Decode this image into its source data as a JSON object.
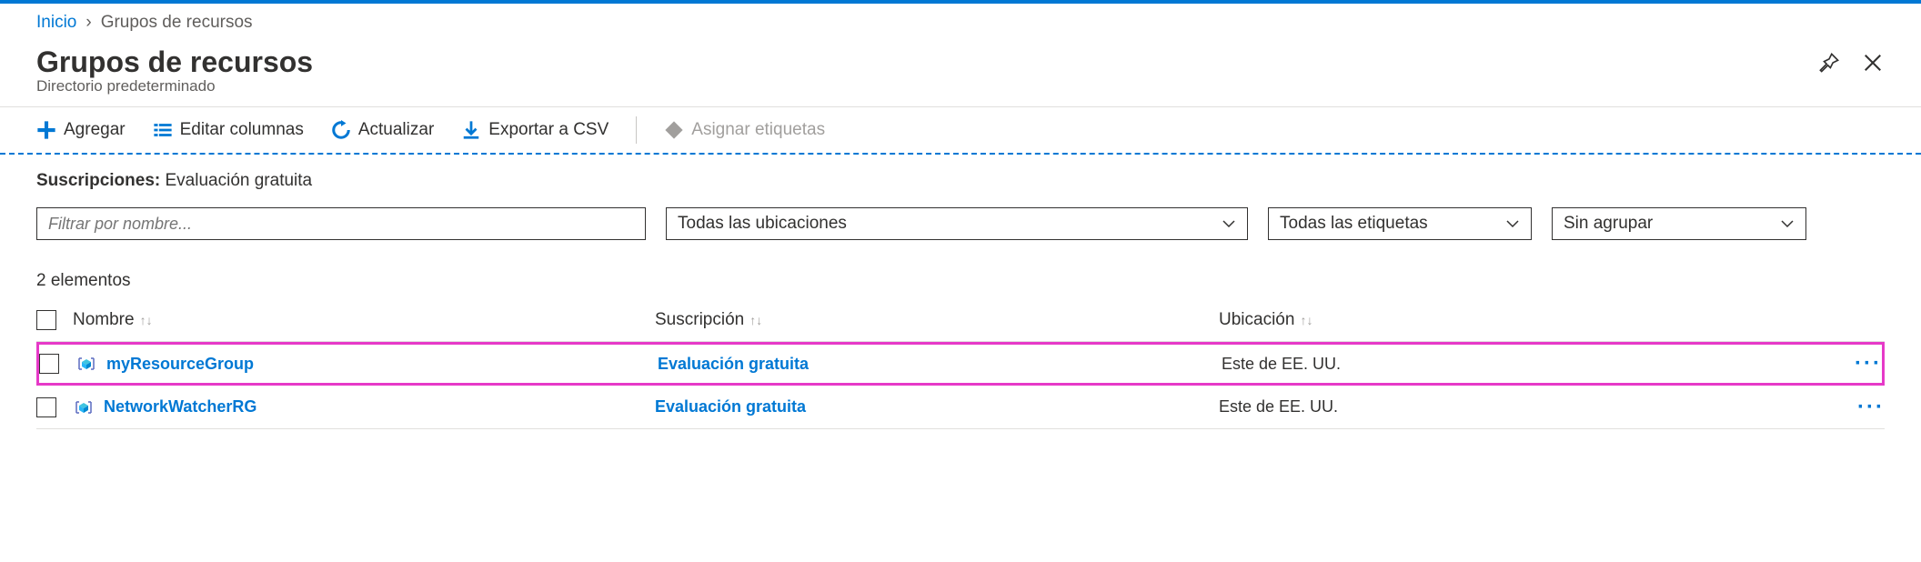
{
  "breadcrumb": {
    "home": "Inicio",
    "sep": "›",
    "current": "Grupos de recursos"
  },
  "header": {
    "title": "Grupos de recursos",
    "subtitle": "Directorio predeterminado"
  },
  "toolbar": {
    "add": "Agregar",
    "edit_columns": "Editar columnas",
    "refresh": "Actualizar",
    "export_csv": "Exportar a CSV",
    "assign_tags": "Asignar etiquetas"
  },
  "subscriptions": {
    "label": "Suscripciones:",
    "value": "Evaluación gratuita"
  },
  "filters": {
    "name_placeholder": "Filtrar por nombre...",
    "locations": "Todas las ubicaciones",
    "tags": "Todas las etiquetas",
    "group": "Sin agrupar"
  },
  "count_label": "2 elementos",
  "columns": {
    "name": "Nombre",
    "subscription": "Suscripción",
    "location": "Ubicación"
  },
  "rows": [
    {
      "name": "myResourceGroup",
      "subscription": "Evaluación gratuita",
      "location": "Este de EE. UU.",
      "highlighted": true
    },
    {
      "name": "NetworkWatcherRG",
      "subscription": "Evaluación gratuita",
      "location": "Este de EE. UU.",
      "highlighted": false
    }
  ]
}
